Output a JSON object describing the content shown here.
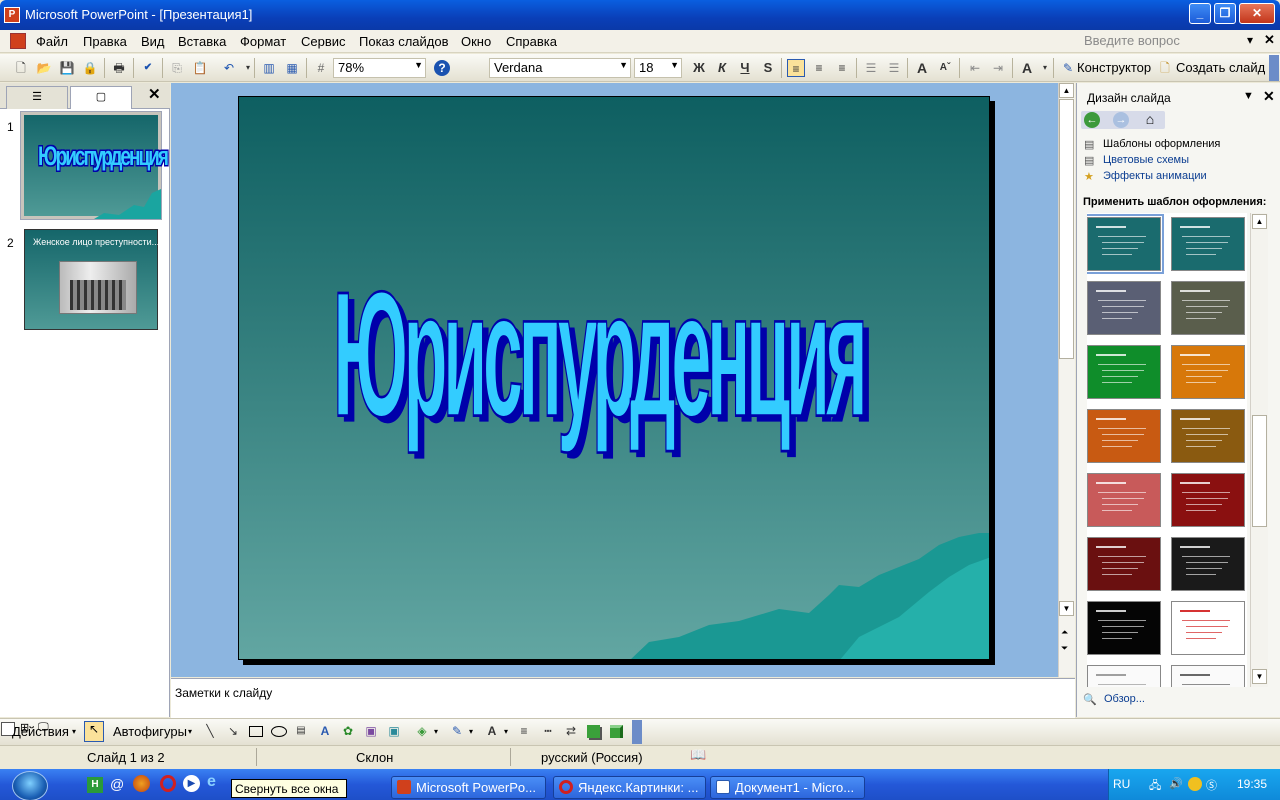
{
  "window": {
    "title": "Microsoft PowerPoint - [Презентация1]"
  },
  "menu": {
    "items": [
      "Файл",
      "Правка",
      "Вид",
      "Вставка",
      "Формат",
      "Сервис",
      "Показ слайдов",
      "Окно",
      "Справка"
    ],
    "ask_placeholder": "Введите вопрос"
  },
  "toolbar": {
    "zoom": "78%",
    "font": "Verdana",
    "size": "18",
    "bold": "Ж",
    "italic": "К",
    "underline": "Ч",
    "shadow": "S",
    "grow": "A",
    "designer": "Конструктор",
    "new_slide": "Создать слайд",
    "font_color": "A"
  },
  "slides_pane": {
    "slides": [
      {
        "num": "1",
        "title": "Юриспурденция"
      },
      {
        "num": "2",
        "title": "Женское лицо преступности..."
      }
    ]
  },
  "slide": {
    "wordart": "Юриспурденция"
  },
  "notes": {
    "placeholder": "Заметки к слайду"
  },
  "taskpane": {
    "title": "Дизайн слайда",
    "links": [
      "Шаблоны оформления",
      "Цветовые схемы",
      "Эффекты анимации"
    ],
    "apply_label": "Применить шаблон оформления:",
    "browse": "Обзор..."
  },
  "drawbar": {
    "actions": "Действия",
    "autoshapes": "Автофигуры"
  },
  "status": {
    "slide": "Слайд 1 из 2",
    "design": "Склон",
    "language": "русский (Россия)"
  },
  "taskbar": {
    "tooltip": "Свернуть все окна",
    "buttons": [
      "Microsoft PowerPo...",
      "Яндекс.Картинки: ...",
      "Документ1 - Micro..."
    ],
    "lang": "RU",
    "time": "19:35"
  },
  "colors": {
    "accent": "#0a5fe0",
    "wordart_fill": "#33CCFF",
    "wordart_edge": "#0000AA",
    "slide_bg": "#3c8684"
  },
  "templates": [
    {
      "bg": "#1a6b6e",
      "fg": "#fff"
    },
    {
      "bg": "#1a6b6e",
      "fg": "#fff"
    },
    {
      "bg": "#5a5f74",
      "fg": "#fff"
    },
    {
      "bg": "#5a5e4c",
      "fg": "#fff"
    },
    {
      "bg": "#0f8d2a",
      "fg": "#fff"
    },
    {
      "bg": "#d7780a",
      "fg": "#fff"
    },
    {
      "bg": "#c85a12",
      "fg": "#fff"
    },
    {
      "bg": "#8a5a10",
      "fg": "#fff"
    },
    {
      "bg": "#c85a5a",
      "fg": "#fff"
    },
    {
      "bg": "#8a1010",
      "fg": "#fff"
    },
    {
      "bg": "#6a1010",
      "fg": "#fff"
    },
    {
      "bg": "#1a1a1a",
      "fg": "#fff"
    },
    {
      "bg": "#050505",
      "fg": "#fff"
    },
    {
      "bg": "#ffffff",
      "fg": "#c00"
    },
    {
      "bg": "#fafafa",
      "fg": "#888"
    },
    {
      "bg": "#fafafa",
      "fg": "#444"
    }
  ]
}
